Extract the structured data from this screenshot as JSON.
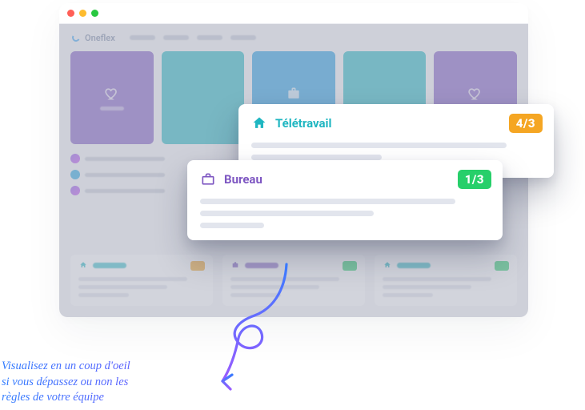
{
  "brand": {
    "name": "Oneflex"
  },
  "popover_remote": {
    "title": "Télétravail",
    "badge": "4/3",
    "icon": "home-icon"
  },
  "popover_office": {
    "title": "Bureau",
    "badge": "1/3",
    "icon": "briefcase-icon"
  },
  "caption": {
    "line1": "Visualisez en un coup d'oeil",
    "line2": "si vous dépassez ou non les",
    "line3": "règles de votre équipe"
  },
  "colors": {
    "teal": "#1fb6c1",
    "purple": "#7e57c2",
    "blue": "#1e9be0",
    "orange": "#f5a623",
    "green": "#27cf6a"
  }
}
